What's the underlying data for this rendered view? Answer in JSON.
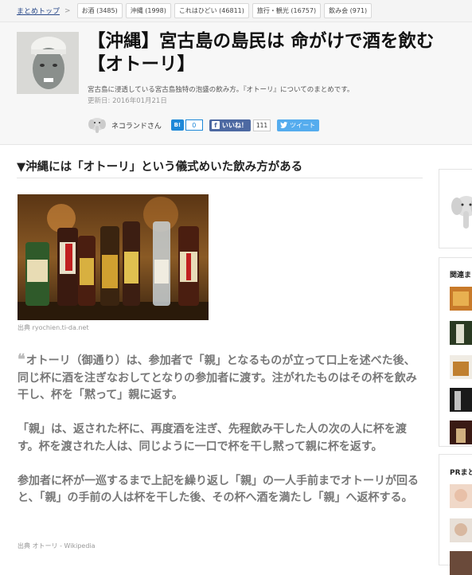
{
  "breadcrumb": {
    "home": "まとめトップ",
    "separator": ">",
    "tags": [
      "お酒 (3485)",
      "沖縄 (1998)",
      "これはひどい (46811)",
      "旅行・観光 (16757)",
      "飲み会 (971)"
    ]
  },
  "article": {
    "title": "【沖縄】宮古島の島民は 命がけで酒を飲む【オトーリ】",
    "description": "宮古島に浸透している宮古島独特の泡盛の飲み方。『オトーリ』についてのまとめです。",
    "updated": "更新日: 2016年01月21日",
    "author": "ネコランドさん",
    "hatena_label": "B!",
    "hatena_count": "0",
    "like_label": "いいね！",
    "like_count": "111",
    "tweet_label": "ツイート"
  },
  "section": {
    "heading": "▼沖縄には「オトーリ」という儀式めいた飲み方がある",
    "photo_source": "出典 ryochien.ti-da.net",
    "quote_mark": "❝",
    "paragraphs": [
      "オトーリ（御通り）は、参加者で「親」となるものが立って口上を述べた後、同じ杯に酒を注ぎなおしてとなりの参加者に渡す。注がれたものはその杯を飲み干し、杯を「黙って」親に返す。",
      "「親」は、返された杯に、再度酒を注ぎ、先程飲み干した人の次の人に杯を渡す。杯を渡された人は、同じように一口で杯を干し黙って親に杯を返す。",
      "参加者に杯が一巡するまで上記を繰り返し「親」の一人手前までオトーリが回ると、「親」の手前の人は杯を干した後、その杯へ酒を満たし「親」へ返杯する。"
    ],
    "quote_source": "出典 オトーリ - Wikipedia"
  },
  "sidebar": {
    "related_title": "関連ま",
    "pr_title": "PRまと"
  },
  "colors": {
    "facebook": "#4d69a2",
    "twitter": "#55acee",
    "hatena": "#1e88d8",
    "link": "#2a4a8a"
  }
}
